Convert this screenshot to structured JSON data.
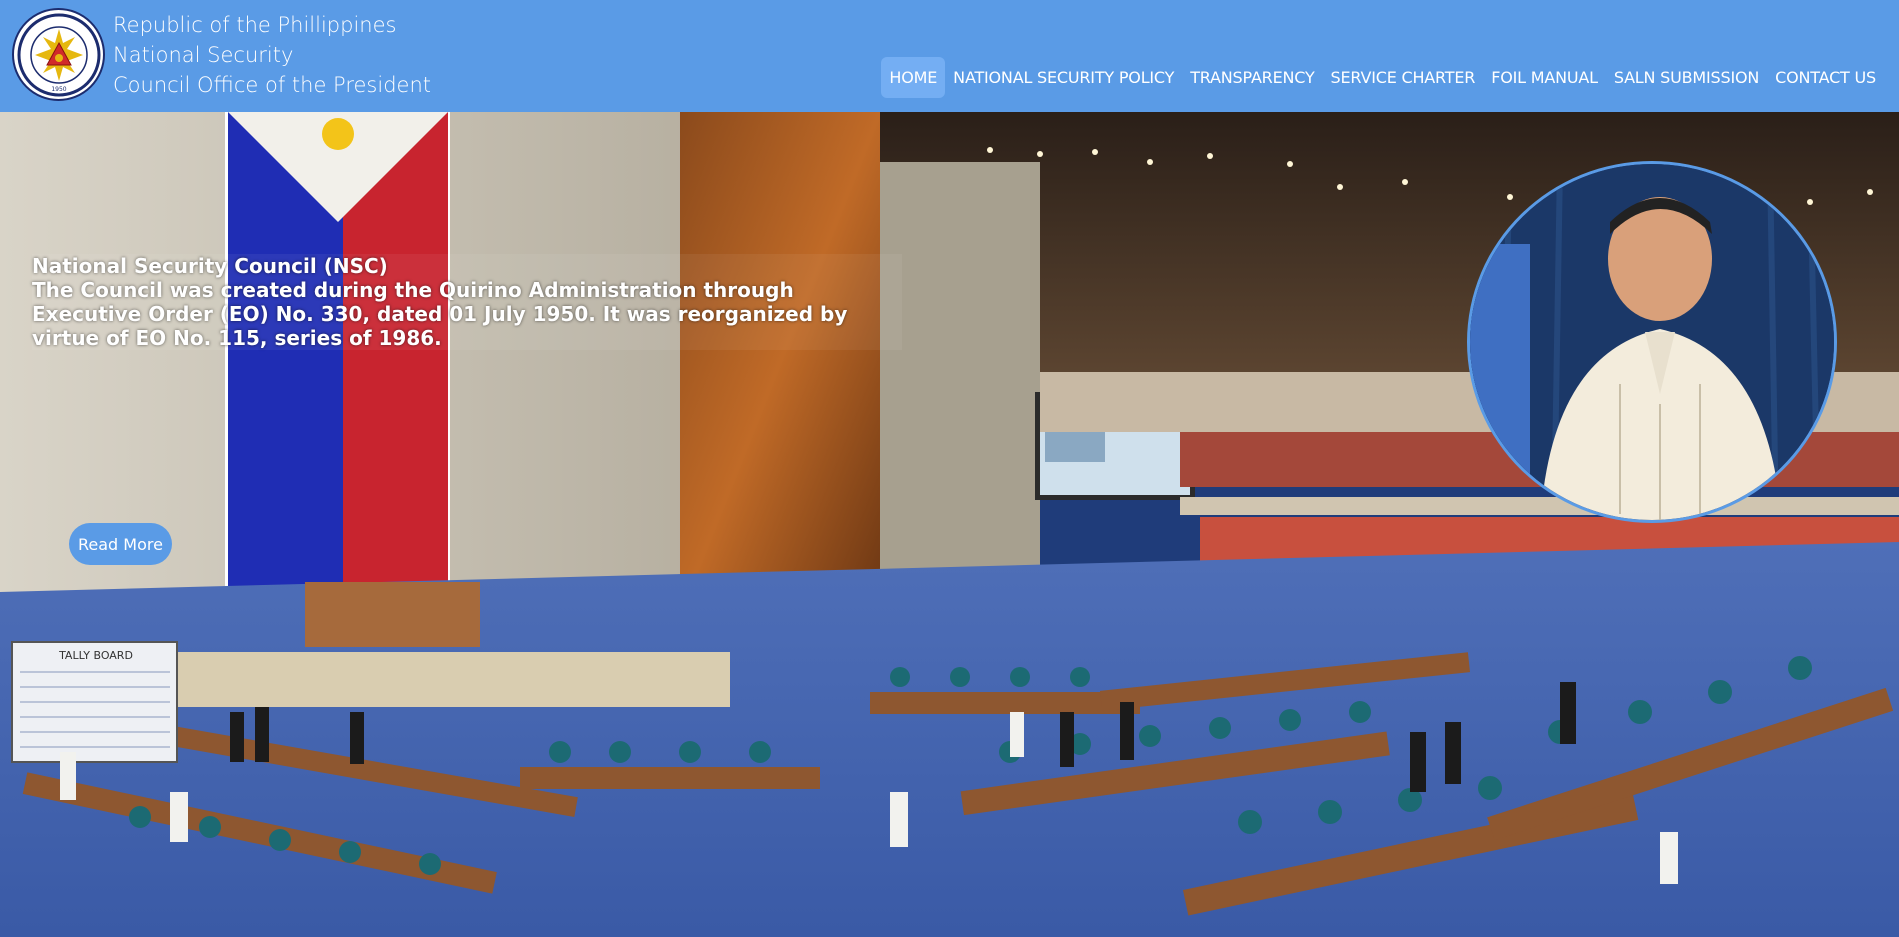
{
  "header": {
    "logo_icon": "nsc-seal-icon",
    "seal_text": "NATIONAL SECURITY COUNCIL 1950",
    "title_lines": [
      "Republic of the Phillippines",
      "National Security",
      "Council Office of the President"
    ]
  },
  "nav": {
    "items": [
      {
        "label": "HOME",
        "active": true
      },
      {
        "label": "NATIONAL SECURITY POLICY",
        "active": false
      },
      {
        "label": "TRANSPARENCY",
        "active": false
      },
      {
        "label": "SERVICE CHARTER",
        "active": false
      },
      {
        "label": "FOIL MANUAL",
        "active": false
      },
      {
        "label": "SALN SUBMISSION",
        "active": false
      },
      {
        "label": "CONTACT US",
        "active": false
      }
    ]
  },
  "hero": {
    "heading": "National Security Council (NSC)",
    "body": "The Council was created during the Quirino Administration through Executive Order (EO) No. 330, dated 01 July 1950. It was reorganized by virtue of EO No. 115, series of 1986.",
    "read_more_label": "Read More",
    "tally_board_text": "TALLY BOARD",
    "background_image": "legislative-session-hall",
    "portrait_image": "president-portrait"
  },
  "colors": {
    "header_bg": "#5a9be6",
    "nav_active_bg": "#74aef3",
    "button_bg": "#5a9be6",
    "text": "#ffffff"
  }
}
